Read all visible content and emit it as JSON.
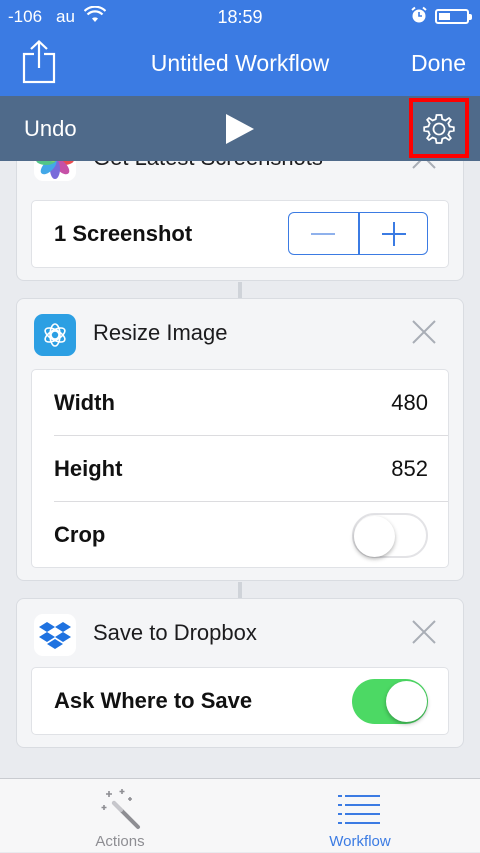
{
  "status_bar": {
    "signal": "-106",
    "carrier": "au",
    "time": "18:59"
  },
  "nav": {
    "title": "Untitled Workflow",
    "done_label": "Done",
    "share_icon": "share-icon"
  },
  "toolbar": {
    "undo_label": "Undo",
    "play_icon": "play-icon",
    "settings_icon": "gear-icon"
  },
  "actions": [
    {
      "title": "Get Latest Screenshots",
      "icon": "photos-icon",
      "rows": [
        {
          "label": "1 Screenshot",
          "control": "stepper"
        }
      ]
    },
    {
      "title": "Resize Image",
      "icon": "resize-image-icon",
      "rows": [
        {
          "label": "Width",
          "value": "480"
        },
        {
          "label": "Height",
          "value": "852"
        },
        {
          "label": "Crop",
          "toggle": false
        }
      ]
    },
    {
      "title": "Save to Dropbox",
      "icon": "dropbox-icon",
      "rows": [
        {
          "label": "Ask Where to Save",
          "toggle": true
        }
      ]
    }
  ],
  "tabs": [
    {
      "label": "Actions",
      "icon": "magic-wand-icon",
      "selected": false
    },
    {
      "label": "Workflow",
      "icon": "list-icon",
      "selected": true
    }
  ],
  "colors": {
    "nav_blue": "#3b7be3",
    "toolbar_slate": "#4f6a8a",
    "toggle_on": "#4cd964",
    "highlight_red": "#ff0000"
  }
}
